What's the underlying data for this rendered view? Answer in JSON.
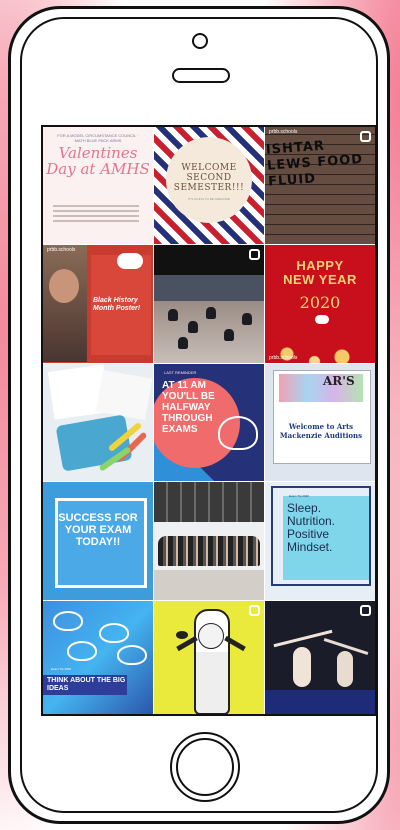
{
  "tiles": {
    "t1": {
      "header": "FOR A MODEL CIRCUMSTANCE COUNCIL · MATH BLUE PACK ARMS",
      "script": "Valentines Day at AMHS"
    },
    "t2": {
      "title": "WELCOME SECOND SEMESTER!!!",
      "sub": "IT'S GOING TO BE AWESOME"
    },
    "t3": {
      "handle": "prbb.schools",
      "graffiti": "ISHTAR LEWS FOOD FLUID"
    },
    "t4": {
      "handle": "prbb.schools",
      "title": "Black History Month Poster!"
    },
    "t6": {
      "line1": "HAPPY",
      "line2": "NEW YEAR",
      "year": "2020",
      "handle": "prbb.schools"
    },
    "t8": {
      "small": "LAST REMINDER",
      "head": "AT 11 AM YOU'LL BE HALFWAY THROUGH EXAMS"
    },
    "t9": {
      "arts": "AR'S",
      "caption": "Welcome to Arts Mackenzie Auditions"
    },
    "t10": {
      "text": "SUCCESS FOR YOUR EXAM TODAY!!"
    },
    "t12": {
      "small": "Exam Tip 2020",
      "text": "Sleep. Nutrition. Positive Mindset."
    },
    "t13": {
      "small": "Exam Tip 2020",
      "text": "THINK ABOUT THE BIG IDEAS"
    }
  },
  "colors": {
    "pink_bg": "#f28a9c",
    "frame": "#111111"
  }
}
